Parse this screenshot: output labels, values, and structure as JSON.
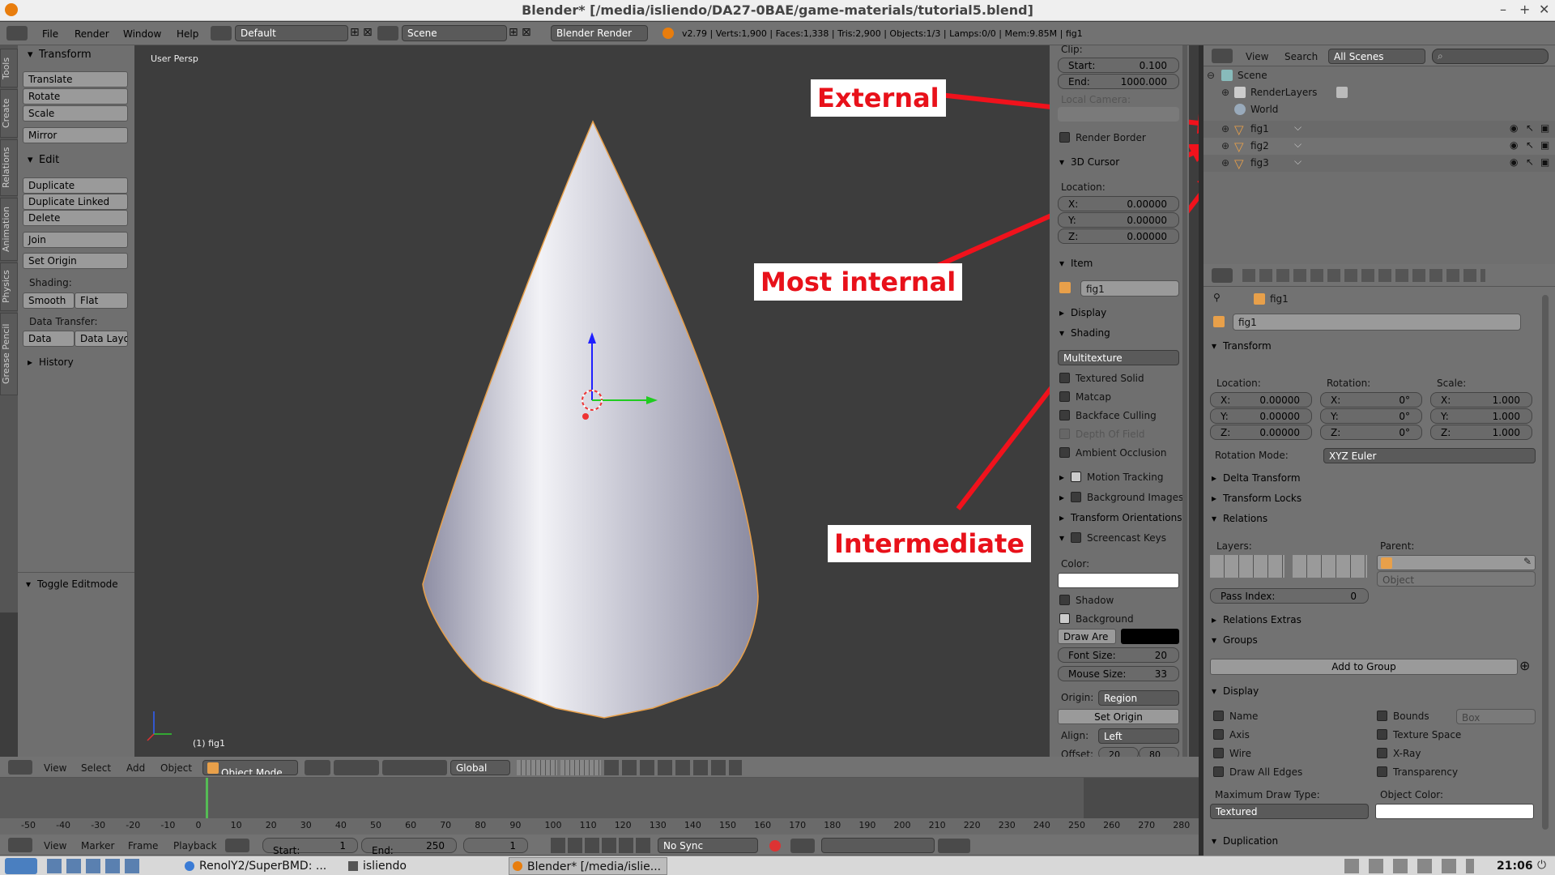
{
  "window": {
    "title": "Blender* [/media/isliendo/DA27-0BAE/game-materials/tutorial5.blend]"
  },
  "topbar": {
    "menus": [
      "File",
      "Render",
      "Window",
      "Help"
    ],
    "layout": "Default",
    "scene": "Scene",
    "engine": "Blender Render",
    "stats": "v2.79 | Verts:1,900 | Faces:1,338 | Tris:2,900 | Objects:1/3 | Lamps:0/0 | Mem:9.85M | fig1"
  },
  "tool_tabs": [
    "Tools",
    "Create",
    "Relations",
    "Animation",
    "Physics",
    "Grease Pencil"
  ],
  "tools": {
    "transform_header": "Transform",
    "translate": "Translate",
    "rotate": "Rotate",
    "scale": "Scale",
    "mirror": "Mirror",
    "edit_header": "Edit",
    "duplicate": "Duplicate",
    "duplicate_linked": "Duplicate Linked",
    "delete": "Delete",
    "join": "Join",
    "set_origin": "Set Origin",
    "shading_label": "Shading:",
    "smooth": "Smooth",
    "flat": "Flat",
    "data_transfer_label": "Data Transfer:",
    "data": "Data",
    "data_layo": "Data Layo",
    "history": "History",
    "toggle_editmode": "Toggle Editmode"
  },
  "viewport": {
    "persp": "User Persp",
    "object_label": "(1) fig1"
  },
  "callouts": {
    "external": "External",
    "most_internal": "Most internal",
    "intermediate": "Intermediate",
    "color": "#e8111a"
  },
  "properties_panel": {
    "clip": "Clip:",
    "start_label": "Start:",
    "start_val": "0.100",
    "end_label": "End:",
    "end_val": "1000.000",
    "local_camera": "Local Camera:",
    "render_border": "Render Border",
    "cursor_header": "3D Cursor",
    "location": "Location:",
    "x_label": "X:",
    "x_val": "0.00000",
    "y_label": "Y:",
    "y_val": "0.00000",
    "z_label": "Z:",
    "z_val": "0.00000",
    "item_header": "Item",
    "item_name": "fig1",
    "display_header": "Display",
    "shading_header": "Shading",
    "shading_mode": "Multitexture",
    "textured_solid": "Textured Solid",
    "matcap": "Matcap",
    "backface": "Backface Culling",
    "dof": "Depth Of Field",
    "ao": "Ambient Occlusion",
    "motion_tracking": "Motion Tracking",
    "bg_images": "Background Images",
    "transform_orient": "Transform Orientations",
    "screencast": "Screencast Keys",
    "color_label": "Color:",
    "shadow": "Shadow",
    "background": "Background",
    "draw_are": "Draw Are",
    "font_size_label": "Font Size:",
    "font_size_val": "20",
    "mouse_size_label": "Mouse Size:",
    "mouse_size_val": "33",
    "origin_label": "Origin:",
    "origin_val": "Region",
    "set_origin": "Set Origin",
    "align_label": "Align:",
    "align_val": "Left",
    "offset_label": "Offset:",
    "offset_x": "20",
    "offset_y": "80"
  },
  "outliner": {
    "view": "View",
    "search": "Search",
    "filter": "All Scenes",
    "scene": "Scene",
    "renderlayers": "RenderLayers",
    "world": "World",
    "objects": [
      "fig1",
      "fig2",
      "fig3"
    ]
  },
  "object_props": {
    "breadcrumb": "fig1",
    "name": "fig1",
    "transform": "Transform",
    "location_label": "Location:",
    "rotation_label": "Rotation:",
    "scale_label": "Scale:",
    "x": "X:",
    "y": "Y:",
    "z": "Z:",
    "loc": [
      "0.00000",
      "0.00000",
      "0.00000"
    ],
    "rot": [
      "0°",
      "0°",
      "0°"
    ],
    "scl": [
      "1.000",
      "1.000",
      "1.000"
    ],
    "rotation_mode_label": "Rotation Mode:",
    "rotation_mode": "XYZ Euler",
    "delta_transform": "Delta Transform",
    "transform_locks": "Transform Locks",
    "relations": "Relations",
    "layers_label": "Layers:",
    "parent_label": "Parent:",
    "parent_type": "Object",
    "pass_index_label": "Pass Index:",
    "pass_index": "0",
    "relations_extras": "Relations Extras",
    "groups": "Groups",
    "add_to_group": "Add to Group",
    "display": "Display",
    "name_cb": "Name",
    "bounds": "Bounds",
    "box": "Box",
    "axis": "Axis",
    "texture_space": "Texture Space",
    "wire": "Wire",
    "xray": "X-Ray",
    "draw_all_edges": "Draw All Edges",
    "transparency": "Transparency",
    "max_draw_type_label": "Maximum Draw Type:",
    "object_color_label": "Object Color:",
    "max_draw_type": "Textured",
    "duplication": "Duplication"
  },
  "view3d_header": {
    "menus": [
      "View",
      "Select",
      "Add",
      "Object"
    ],
    "mode": "Object Mode",
    "orientation": "Global"
  },
  "timeline": {
    "ticks": [
      "-50",
      "-40",
      "-30",
      "-20",
      "-10",
      "0",
      "10",
      "20",
      "30",
      "40",
      "50",
      "60",
      "70",
      "80",
      "90",
      "100",
      "110",
      "120",
      "130",
      "140",
      "150",
      "160",
      "170",
      "180",
      "190",
      "200",
      "210",
      "220",
      "230",
      "240",
      "250",
      "260",
      "270",
      "280"
    ],
    "menus": [
      "View",
      "Marker",
      "Frame",
      "Playback"
    ],
    "start_label": "Start:",
    "start_val": "1",
    "end_label": "End:",
    "end_val": "250",
    "current": "1",
    "sync": "No Sync"
  },
  "taskbar": {
    "items": [
      "RenolY2/SuperBMD: ...",
      "isliendo",
      "Blender* [/media/islie..."
    ],
    "clock": "21:06"
  }
}
